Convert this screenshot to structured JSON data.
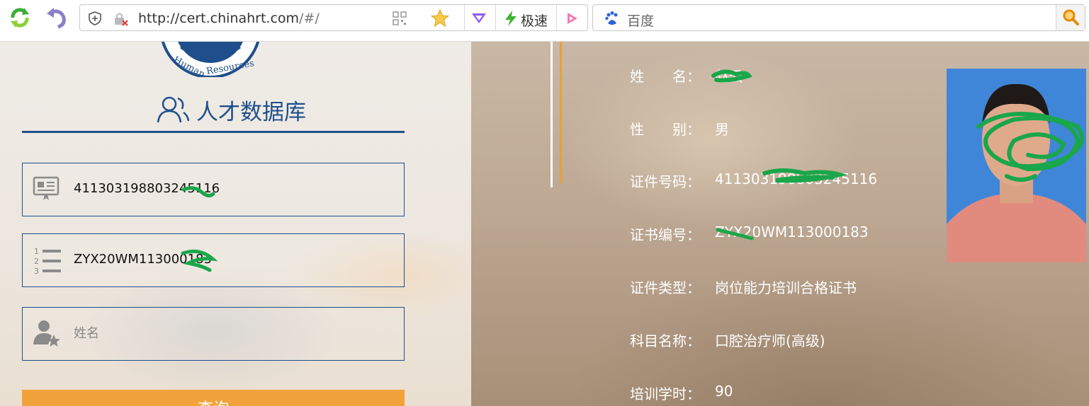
{
  "browser": {
    "url_host": "http://cert.chinahrt.com",
    "url_path": "/#/",
    "speed_label": "极速",
    "search_placeholder": "百度"
  },
  "login": {
    "title": "人才数据库",
    "id_number_value": "411303198803245116",
    "cert_number_value": "ZYX20WM113000183",
    "name_placeholder": "姓名",
    "query_button": "查询"
  },
  "result": {
    "rows": [
      {
        "label": "姓　　名：",
        "value": "赵云"
      },
      {
        "label": "性　　别：",
        "value": "男"
      },
      {
        "label": "证件号码：",
        "value": "411303198803245116"
      },
      {
        "label": "证书编号：",
        "value": "ZYX20WM113000183"
      },
      {
        "label": "证件类型：",
        "value": "岗位能力培训合格证书"
      },
      {
        "label": "科目名称：",
        "value": "口腔治疗师(高级)"
      },
      {
        "label": "培训学时：",
        "value": "90"
      }
    ]
  },
  "colors": {
    "brand_blue": "#1e4f8c",
    "query_orange": "#f2a23a",
    "photo_background": "#3f86d9",
    "scribble_green": "#1aa64a"
  }
}
